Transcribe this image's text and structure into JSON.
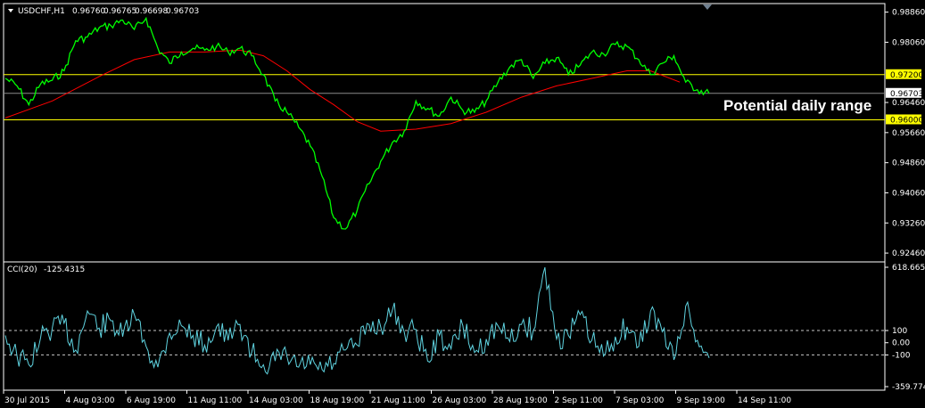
{
  "chart_data": [
    {
      "type": "line",
      "symbol": "USDCHF",
      "timeframe": "H1",
      "header": {
        "label": "USDCHF,H1",
        "ohlc": [
          "0.96760",
          "0.96765",
          "0.96698",
          "0.96703"
        ]
      },
      "ylim": [
        0.9232,
        0.9904
      ],
      "yticks": [
        "0.98860",
        "0.98060",
        "0.96460",
        "0.95660",
        "0.94860",
        "0.94060",
        "0.93260",
        "0.92460"
      ],
      "last_price": "0.96703",
      "levels": [
        {
          "label": "0.97200",
          "value": 0.972,
          "color": "#ffff00"
        },
        {
          "label": "0.96000",
          "value": 0.96,
          "color": "#ffff00"
        }
      ],
      "annotation": "Potential daily range",
      "series": [
        {
          "role": "price",
          "color": "#00ff00",
          "x": [
            0,
            2,
            4,
            6,
            8,
            10,
            12,
            14,
            16,
            18,
            20,
            22,
            24,
            26,
            28,
            30,
            32,
            34,
            36,
            38,
            40,
            42,
            44,
            46,
            48,
            50,
            52,
            54,
            56,
            58,
            60,
            62,
            64,
            66,
            68,
            70,
            72,
            74,
            76,
            78,
            80,
            82,
            84,
            86,
            88,
            90,
            92,
            94,
            96,
            98,
            100,
            102,
            104,
            106,
            108,
            110,
            112,
            114,
            116,
            118,
            120
          ],
          "values": [
            0.971,
            0.969,
            0.964,
            0.9695,
            0.9705,
            0.973,
            0.981,
            0.982,
            0.9845,
            0.985,
            0.9865,
            0.984,
            0.987,
            0.979,
            0.975,
            0.978,
            0.979,
            0.9785,
            0.9795,
            0.978,
            0.979,
            0.977,
            0.972,
            0.965,
            0.962,
            0.958,
            0.953,
            0.945,
            0.934,
            0.931,
            0.936,
            0.943,
            0.949,
            0.954,
            0.957,
            0.965,
            0.963,
            0.961,
            0.966,
            0.9625,
            0.962,
            0.965,
            0.97,
            0.974,
            0.976,
            0.971,
            0.975,
            0.9765,
            0.972,
            0.9745,
            0.978,
            0.9775,
            0.98,
            0.9795,
            0.976,
            0.972,
            0.975,
            0.977,
            0.97,
            0.968,
            0.967
          ]
        },
        {
          "role": "moving-average",
          "color": "#ff0000",
          "x": [
            0,
            8,
            16,
            22,
            28,
            34,
            40,
            44,
            48,
            52,
            56,
            60,
            64,
            70,
            76,
            82,
            88,
            94,
            100,
            106,
            110,
            115
          ],
          "values": [
            0.9605,
            0.965,
            0.9715,
            0.976,
            0.978,
            0.978,
            0.9785,
            0.977,
            0.973,
            0.968,
            0.964,
            0.9595,
            0.957,
            0.9575,
            0.959,
            0.962,
            0.966,
            0.969,
            0.971,
            0.973,
            0.973,
            0.97
          ]
        }
      ],
      "xticks": [
        "30 Jul 2015",
        "4 Aug 03:00",
        "6 Aug 19:00",
        "11 Aug 11:00",
        "14 Aug 03:00",
        "18 Aug 19:00",
        "21 Aug 11:00",
        "26 Aug 03:00",
        "28 Aug 19:00",
        "2 Sep 11:00",
        "7 Sep 03:00",
        "9 Sep 19:00",
        "14 Sep 11:00"
      ],
      "xtick_pos": [
        0,
        11,
        22,
        33,
        44,
        55,
        66,
        77,
        88,
        99,
        110,
        121,
        132
      ]
    },
    {
      "type": "line",
      "indicator": "CCI",
      "header": {
        "label": "CCI(20)",
        "value": "-125.4315"
      },
      "ylim": [
        -359.7745,
        618.6654
      ],
      "yticks": [
        "618.6654",
        "100",
        "0.00",
        "-100",
        "-359.7745"
      ],
      "levels": [
        100,
        -100
      ],
      "series": [
        {
          "role": "cci",
          "color": "#5fd3e0",
          "x": [
            0,
            2,
            4,
            6,
            8,
            10,
            12,
            14,
            16,
            18,
            20,
            22,
            24,
            26,
            28,
            30,
            32,
            34,
            36,
            38,
            40,
            42,
            44,
            46,
            48,
            50,
            52,
            54,
            56,
            58,
            60,
            62,
            64,
            66,
            68,
            70,
            72,
            74,
            76,
            78,
            80,
            82,
            84,
            86,
            88,
            90,
            92,
            94,
            96,
            98,
            100,
            102,
            104,
            106,
            108,
            110,
            112,
            114,
            116,
            118,
            120
          ],
          "values": [
            60,
            -110,
            -180,
            40,
            120,
            160,
            -60,
            260,
            120,
            180,
            50,
            230,
            -30,
            -200,
            80,
            140,
            60,
            -20,
            130,
            20,
            150,
            -80,
            -180,
            -150,
            -110,
            -200,
            -180,
            -220,
            -170,
            -60,
            -20,
            150,
            130,
            270,
            90,
            110,
            -150,
            60,
            -50,
            140,
            -80,
            30,
            140,
            10,
            150,
            100,
            618,
            30,
            60,
            230,
            20,
            -110,
            50,
            130,
            -30,
            260,
            90,
            -140,
            300,
            20,
            -125
          ]
        }
      ]
    }
  ]
}
